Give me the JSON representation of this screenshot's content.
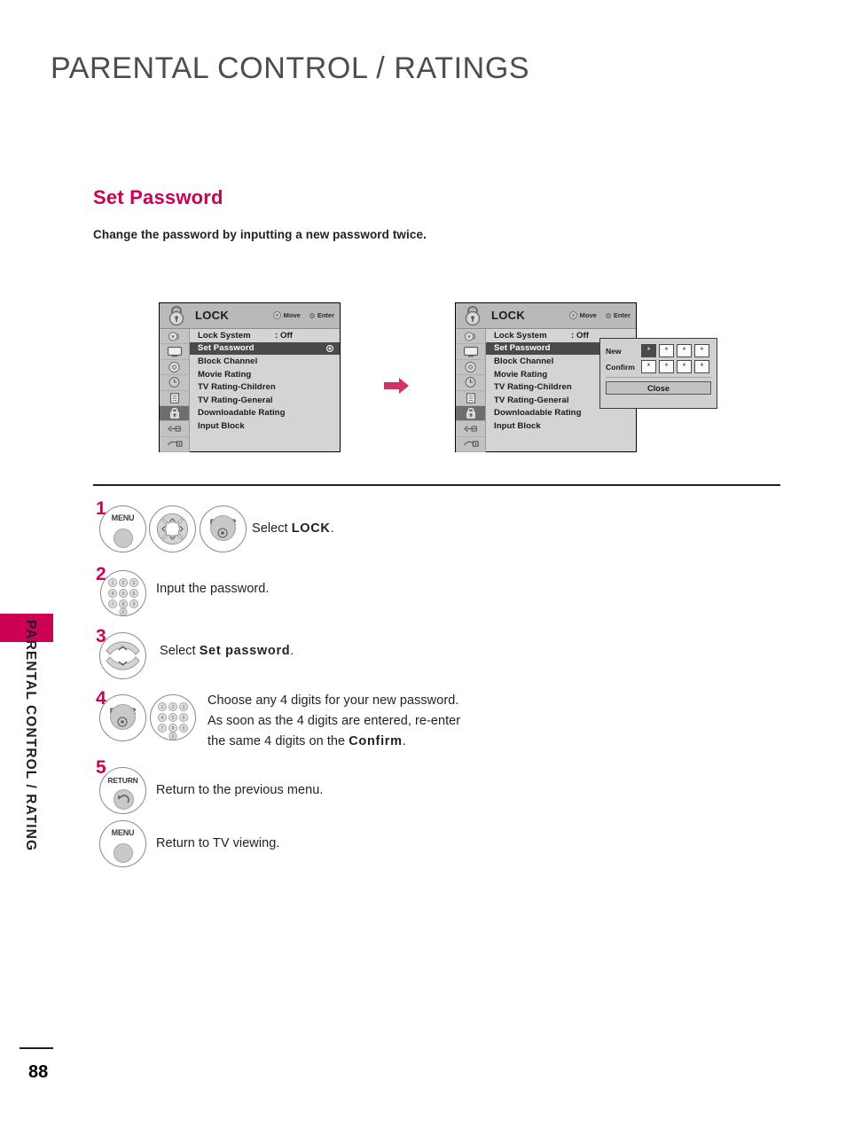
{
  "page": {
    "header_title": "PARENTAL CONTROL / RATINGS",
    "side_tab_text": "PARENTAL CONTROL / RATING",
    "page_number": "88",
    "accent_color": "#cc0055",
    "header_color": "#4d4d4f"
  },
  "section": {
    "title": "Set Password",
    "subtitle": "Change the password by inputting a new password twice."
  },
  "osd": {
    "title": "LOCK",
    "hints": [
      {
        "icon": "dpad-icon",
        "label": "Move"
      },
      {
        "icon": "enter-dot-icon",
        "label": "Enter"
      }
    ],
    "rail_icons": [
      "audio-icon",
      "picture-icon",
      "setup-gear-icon",
      "time-icon",
      "option-icon",
      "lock-icon",
      "input-icon",
      "usb-icon"
    ],
    "rail_active_index": 5,
    "menu_items": [
      {
        "label": "Lock System",
        "value": ": Off",
        "selected": false,
        "radio": false
      },
      {
        "label": "Set Password",
        "value": "",
        "selected": true,
        "radio": true
      },
      {
        "label": "Block Channel",
        "value": "",
        "selected": false,
        "radio": false
      },
      {
        "label": "Movie Rating",
        "value": "",
        "selected": false,
        "radio": false
      },
      {
        "label": "TV Rating-Children",
        "value": "",
        "selected": false,
        "radio": false
      },
      {
        "label": "TV Rating-General",
        "value": "",
        "selected": false,
        "radio": false
      },
      {
        "label": "Downloadable Rating",
        "value": "",
        "selected": false,
        "radio": false
      },
      {
        "label": "Input Block",
        "value": "",
        "selected": false,
        "radio": false
      }
    ]
  },
  "password_dialog": {
    "new_label": "New",
    "confirm_label": "Confirm",
    "new_cells": [
      "*",
      "*",
      "*",
      "*"
    ],
    "confirm_cells": [
      "*",
      "*",
      "*",
      "*"
    ],
    "focused_cell_index": 0,
    "close_label": "Close"
  },
  "flow": {
    "arrow_icon": "right-arrow-icon",
    "arrow_color": "#cc3366"
  },
  "steps": [
    {
      "num": "1",
      "buttons": [
        "menu-button",
        "dpad-button",
        "enter-button"
      ],
      "menu_label": "MENU",
      "enter_label": "ENTER",
      "text_pre": "Select ",
      "text_bold": "LOCK",
      "text_post": "."
    },
    {
      "num": "2",
      "buttons": [
        "number-keypad-button"
      ],
      "text_pre": "Input the password.",
      "text_bold": "",
      "text_post": ""
    },
    {
      "num": "3",
      "buttons": [
        "up-down-button"
      ],
      "text_pre": "Select ",
      "text_bold": "Set password",
      "text_post": "."
    },
    {
      "num": "4",
      "buttons": [
        "enter-button",
        "number-keypad-button"
      ],
      "enter_label": "ENTER",
      "line1": "Choose any 4 digits for your new password.",
      "line2": "As soon as the 4 digits are entered, re-enter",
      "line3_pre": "the same 4 digits on the ",
      "line3_bold": "Confirm",
      "line3_post": "."
    },
    {
      "num": "5",
      "buttons": [
        "return-button"
      ],
      "return_label": "RETURN",
      "text_pre": "Return to the previous menu.",
      "text_bold": "",
      "text_post": ""
    },
    {
      "num": "",
      "buttons": [
        "menu-button"
      ],
      "menu_label": "MENU",
      "text_pre": "Return to TV viewing.",
      "text_bold": "",
      "text_post": ""
    }
  ],
  "keypad_digits": [
    "1",
    "2",
    "3",
    "4",
    "5",
    "6",
    "7",
    "8",
    "9",
    "0"
  ]
}
